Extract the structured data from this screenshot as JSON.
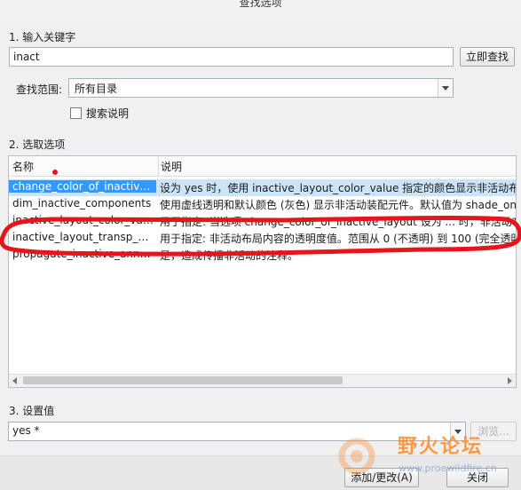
{
  "window": {
    "title": "查找选项"
  },
  "step1": {
    "label": "1.  输入关键字",
    "keyword": "inact",
    "search_button": "立即查找"
  },
  "scope": {
    "label": "查找范围:",
    "value": "所有目录",
    "search_desc_label": "搜索说明"
  },
  "step2": {
    "label": "2.  选取选项"
  },
  "table": {
    "columns": [
      "名称",
      "说明"
    ],
    "rows": [
      {
        "name": "change_color_of_inactive_...",
        "desc": "设为 yes 时，使用 inactive_layout_color_value 指定的颜色显示非活动布局",
        "selected": true
      },
      {
        "name": "dim_inactive_components",
        "desc": "使用虚线透明和默认颜色 (灰色) 显示非活动装配元件。默认值为 shade_onl",
        "selected": false
      },
      {
        "name": "inactive_layout_color_value",
        "desc": "用于指定: 当选项 change_color_of_inactive_layout 设为 ... 时，非活动布",
        "selected": false
      },
      {
        "name": "inactive_layout_transp_val...",
        "desc": "用于指定: 非活动布局内容的透明度值。范围从 0 (不透明) 到 100 (完全透明",
        "selected": false
      },
      {
        "name": "propagate_inactive_anno...",
        "desc": "是，造成传播非活动的注释。",
        "selected": false
      }
    ]
  },
  "step3": {
    "label": "3.  设置值",
    "value": "yes *",
    "browse_button": "浏览..."
  },
  "footer": {
    "apply_button": "添加/更改(A)",
    "close_button": "关闭"
  },
  "watermark": {
    "text": "野火论坛",
    "url": "www.proewildfire.cn"
  },
  "colors": {
    "selection": "#3399ff",
    "annotation": "#e8141b",
    "watermark": "#ff8a2a"
  }
}
